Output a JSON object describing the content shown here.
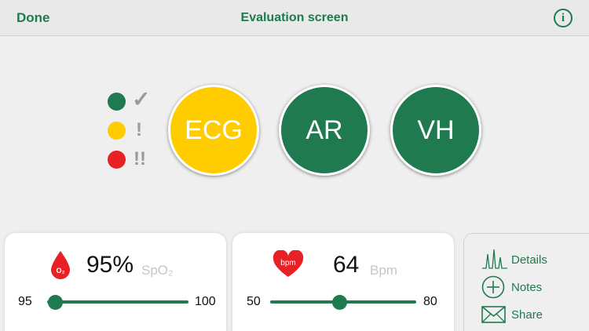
{
  "navbar": {
    "done_label": "Done",
    "title": "Evaluation screen",
    "info_icon": "info-icon"
  },
  "legend": [
    {
      "color": "#1f7a4f",
      "symbol": "✓",
      "icon": "checkmark-icon"
    },
    {
      "color": "#ffcc00",
      "symbol": "!",
      "icon": "exclamation-icon"
    },
    {
      "color": "#e82127",
      "symbol": "!!",
      "icon": "double-exclamation-icon"
    }
  ],
  "indicators": [
    {
      "label": "ECG",
      "color": "#ffcc00"
    },
    {
      "label": "AR",
      "color": "#1f7a4f"
    },
    {
      "label": "VH",
      "color": "#1f7a4f"
    }
  ],
  "spo2_card": {
    "icon_text": "O₂",
    "value": "95%",
    "unit": "SpO₂",
    "min_label": "95",
    "max_label": "100",
    "slider_fraction": 0.0
  },
  "bpm_card": {
    "icon_text": "bpm",
    "value": "64",
    "unit": "Bpm",
    "min_label": "50",
    "max_label": "80",
    "slider_fraction": 0.47
  },
  "side_menu": {
    "details_label": "Details",
    "notes_label": "Notes",
    "share_label": "Share"
  },
  "colors": {
    "accent": "#1f7a4f",
    "warning": "#ffcc00",
    "danger": "#e82127"
  }
}
